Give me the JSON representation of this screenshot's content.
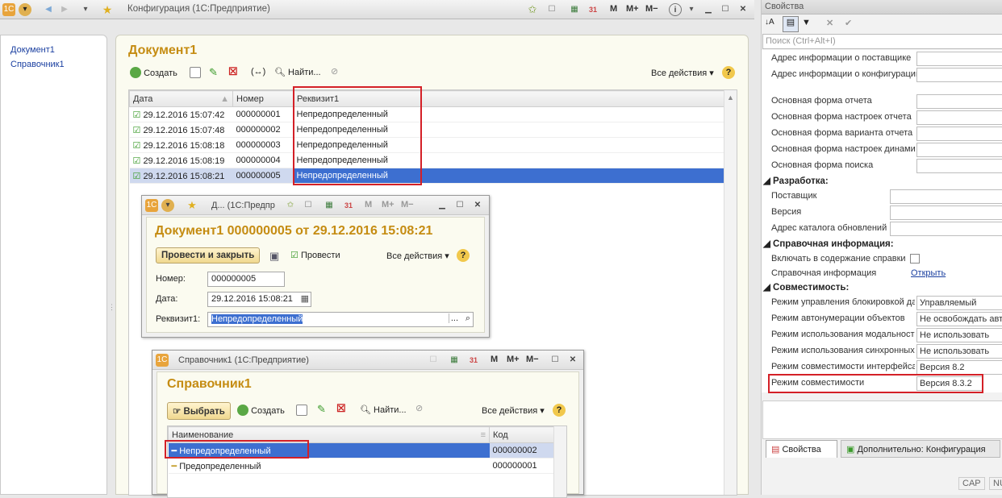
{
  "app": {
    "title": "Конфигурация  (1С:Предприятие)",
    "m": "M",
    "mplus": "M+",
    "mminus": "M−"
  },
  "nav": {
    "items": [
      "Документ1",
      "Справочник1"
    ]
  },
  "doc_list": {
    "title": "Документ1",
    "toolbar": {
      "create": "Создать",
      "find": "Найти...",
      "all_actions": "Все действия"
    },
    "columns": [
      "Дата",
      "Номер",
      "Реквизит1"
    ],
    "rows": [
      {
        "date": "29.12.2016 15:07:42",
        "num": "000000001",
        "attr": "Непредопределенный"
      },
      {
        "date": "29.12.2016 15:07:48",
        "num": "000000002",
        "attr": "Непредопределенный"
      },
      {
        "date": "29.12.2016 15:08:18",
        "num": "000000003",
        "attr": "Непредопределенный"
      },
      {
        "date": "29.12.2016 15:08:19",
        "num": "000000004",
        "attr": "Непредопределенный"
      },
      {
        "date": "29.12.2016 15:08:21",
        "num": "000000005",
        "attr": "Непредопределенный"
      }
    ],
    "selected_row": 4
  },
  "doc_form": {
    "window_title": "Д...  (1С:Предпр",
    "title": "Документ1 000000005 от 29.12.2016 15:08:21",
    "post_close": "Провести и закрыть",
    "post": "Провести",
    "all_actions": "Все действия",
    "number_label": "Номер:",
    "number_value": "000000005",
    "date_label": "Дата:",
    "date_value": "29.12.2016 15:08:21",
    "attr_label": "Реквизит1:",
    "attr_value": "Непредопределенный"
  },
  "catalog": {
    "window_title": "Справочник1  (1С:Предприятие)",
    "title": "Справочник1",
    "select": "Выбрать",
    "create": "Создать",
    "find": "Найти...",
    "all_actions": "Все действия",
    "columns": [
      "Наименование",
      "Код"
    ],
    "rows": [
      {
        "name": "Непредопределенный",
        "code": "000000002"
      },
      {
        "name": "Предопределенный",
        "code": "000000001"
      }
    ]
  },
  "props": {
    "title": "Свойства",
    "search_placeholder": "Поиск (Ctrl+Alt+I)",
    "rows1": [
      {
        "label": "Адрес информации о поставщике",
        "value": ""
      },
      {
        "label": "Адрес информации о конфигурации",
        "value": ""
      }
    ],
    "rows2": [
      {
        "label": "Основная форма отчета",
        "value": ""
      },
      {
        "label": "Основная форма настроек отчета",
        "value": ""
      },
      {
        "label": "Основная форма варианта отчета",
        "value": ""
      },
      {
        "label": "Основная форма настроек динами",
        "value": ""
      },
      {
        "label": "Основная форма поиска",
        "value": ""
      }
    ],
    "section_dev": "Разработка:",
    "dev_rows": [
      {
        "label": "Поставщик",
        "value": ""
      },
      {
        "label": "Версия",
        "value": ""
      },
      {
        "label": "Адрес каталога обновлений",
        "value": ""
      }
    ],
    "section_help": "Справочная информация:",
    "help_include": "Включать в содержание справки",
    "help_info": "Справочная информация",
    "help_open": "Открыть",
    "section_compat": "Совместимость:",
    "compat_rows": [
      {
        "label": "Режим управления блокировкой да",
        "value": "Управляемый"
      },
      {
        "label": "Режим автонумерации объектов",
        "value": "Не освобождать авт"
      },
      {
        "label": "Режим использования модальност",
        "value": "Не использовать"
      },
      {
        "label": "Режим использования синхронных",
        "value": "Не использовать"
      },
      {
        "label": "Режим совместимости интерфейса",
        "value": "Версия 8.2"
      },
      {
        "label": "Режим совместимости",
        "value": "Версия 8.3.2"
      }
    ],
    "tab_props": "Свойства",
    "tab_extra": "Дополнительно: Конфигурация",
    "status_cap": "CAP",
    "status_num": "NU"
  }
}
